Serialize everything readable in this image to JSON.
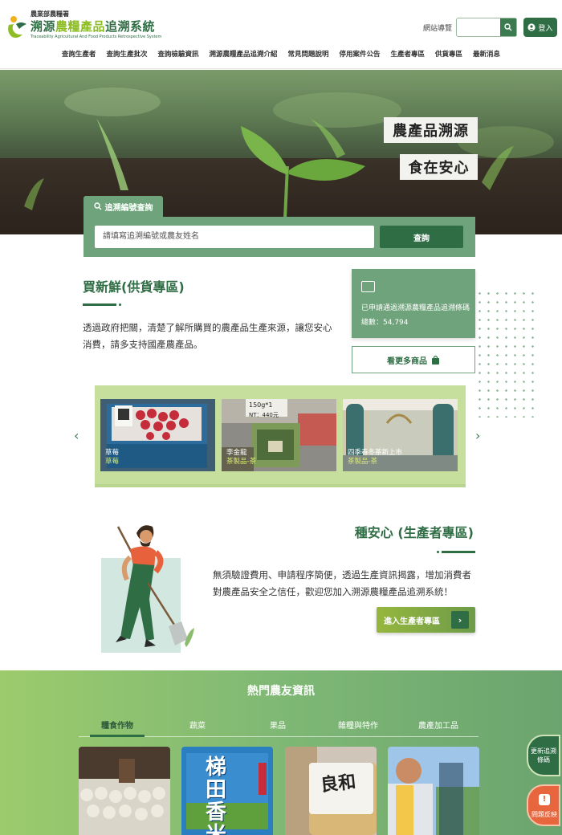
{
  "header": {
    "org": "農業部農糧署",
    "title_prefix": "溯源",
    "title_highlight": "農糧產品",
    "title_suffix": "追溯系統",
    "title_en": "Traceability Agricultural And Food Products Retrospective System",
    "sitemap_label": "網站導覽",
    "login_label": "登入"
  },
  "nav": [
    "查詢生產者",
    "查詢生產批次",
    "查詢檢驗資訊",
    "溯源農糧產品追溯介紹",
    "常見問題說明",
    "停用案件公告",
    "生產者專區",
    "供貨專區",
    "最新消息"
  ],
  "hero": {
    "line1": "農產品溯源",
    "line2": "食在安心"
  },
  "trace": {
    "tab_label": "追溯編號查詢",
    "input_placeholder": "請填寫追溯編號或農友姓名",
    "submit_label": "查詢"
  },
  "buy": {
    "title": "買新鮮(供貨專區)",
    "description": "透過政府把關，清楚了解所購買的農產品生產來源，讓您安心消費，請多支持國產農產品。",
    "stat_text": "已申請通過溯源農糧產品追溯條碼總數：54,794",
    "more_label": "看更多商品"
  },
  "carousel": {
    "items": [
      {
        "title": "草莓",
        "category": "草莓"
      },
      {
        "title": "李金龍",
        "category": "茶製品-茶"
      },
      {
        "title": "四季春冬茶新上市",
        "category": "茶製品-茶"
      }
    ],
    "card2_tag1": "150g*1",
    "card2_tag2": "NT：440元"
  },
  "plant": {
    "title": "種安心 (生產者專區)",
    "description": "無須驗證費用、申請程序簡便，透過生產資訊揭露，增加消費者對農產品安全之信任，歡迎您加入溯源農糧產品追溯系統！",
    "enter_label": "進入生產者專區"
  },
  "hot": {
    "title": "熱門農友資訊",
    "tabs": [
      "糧食作物",
      "蔬菜",
      "果品",
      "雜糧與特作",
      "農產加工品"
    ],
    "card2_text": "梯田香米",
    "card3_text": "良和"
  },
  "floating": {
    "update_label": "更新追溯條碼",
    "report_label": "問題反映"
  },
  "colors": {
    "primary": "#2f6d44",
    "accent": "#6fa37b",
    "lime": "#8cbd22",
    "report": "#e8663e"
  }
}
